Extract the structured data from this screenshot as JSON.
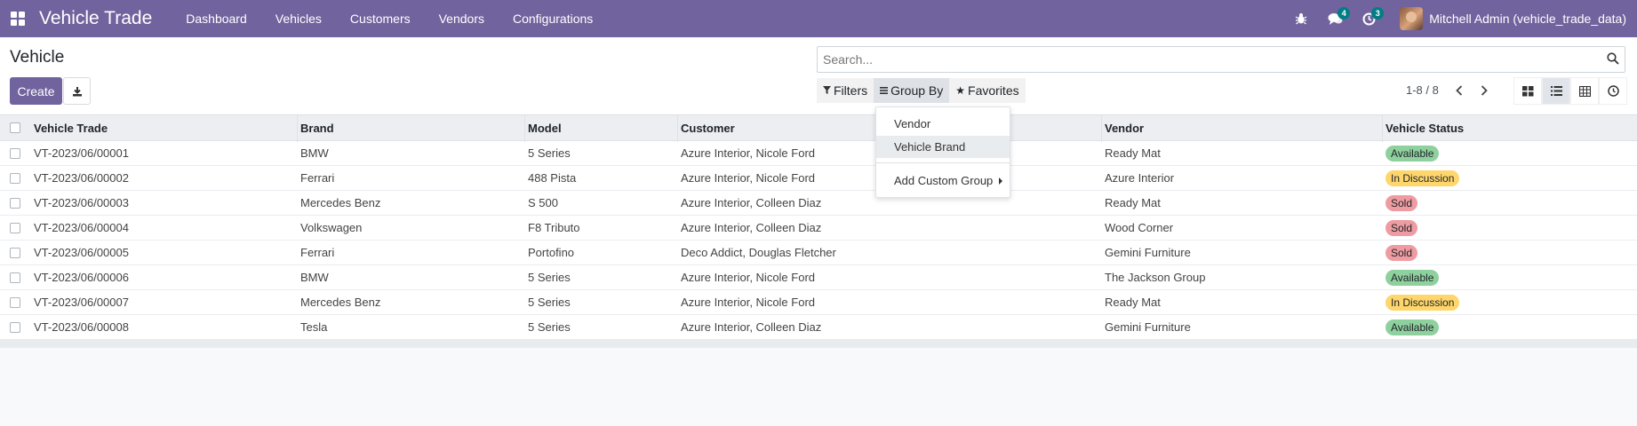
{
  "navbar": {
    "app_title": "Vehicle Trade",
    "menu": [
      "Dashboard",
      "Vehicles",
      "Customers",
      "Vendors",
      "Configurations"
    ],
    "messages_count": "4",
    "activities_count": "3",
    "user_name": "Mitchell Admin (vehicle_trade_data)"
  },
  "control": {
    "page_title": "Vehicle",
    "create_label": "Create",
    "search_placeholder": "Search...",
    "filters_label": "Filters",
    "groupby_label": "Group By",
    "favorites_label": "Favorites",
    "pager": "1-8 / 8"
  },
  "table": {
    "headers": [
      "Vehicle Trade",
      "Brand",
      "Model",
      "Customer",
      "Vendor",
      "Vehicle Status"
    ],
    "rows": [
      {
        "trade": "VT-2023/06/00001",
        "brand": "BMW",
        "model": "5 Series",
        "customer": "Azure Interior, Nicole Ford",
        "vendor": "Ready Mat",
        "status": "Available"
      },
      {
        "trade": "VT-2023/06/00002",
        "brand": "Ferrari",
        "model": "488 Pista",
        "customer": "Azure Interior, Nicole Ford",
        "vendor": "Azure Interior",
        "status": "In Discussion"
      },
      {
        "trade": "VT-2023/06/00003",
        "brand": "Mercedes Benz",
        "model": "S 500",
        "customer": "Azure Interior, Colleen Diaz",
        "vendor": "Ready Mat",
        "status": "Sold"
      },
      {
        "trade": "VT-2023/06/00004",
        "brand": "Volkswagen",
        "model": "F8 Tributo",
        "customer": "Azure Interior, Colleen Diaz",
        "vendor": "Wood Corner",
        "status": "Sold"
      },
      {
        "trade": "VT-2023/06/00005",
        "brand": "Ferrari",
        "model": "Portofino",
        "customer": "Deco Addict, Douglas Fletcher",
        "vendor": "Gemini Furniture",
        "status": "Sold"
      },
      {
        "trade": "VT-2023/06/00006",
        "brand": "BMW",
        "model": "5 Series",
        "customer": "Azure Interior, Nicole Ford",
        "vendor": "The Jackson Group",
        "status": "Available"
      },
      {
        "trade": "VT-2023/06/00007",
        "brand": "Mercedes Benz",
        "model": "5 Series",
        "customer": "Azure Interior, Nicole Ford",
        "vendor": "Ready Mat",
        "status": "In Discussion"
      },
      {
        "trade": "VT-2023/06/00008",
        "brand": "Tesla",
        "model": "5 Series",
        "customer": "Azure Interior, Colleen Diaz",
        "vendor": "Gemini Furniture",
        "status": "Available"
      }
    ]
  },
  "groupby_menu": {
    "items": [
      "Vendor",
      "Vehicle Brand"
    ],
    "custom": "Add Custom Group"
  },
  "colors": {
    "navbar": "#71639e",
    "available": "#8fd19e",
    "in_discussion": "#ffd66b",
    "sold": "#ee9ca1"
  }
}
